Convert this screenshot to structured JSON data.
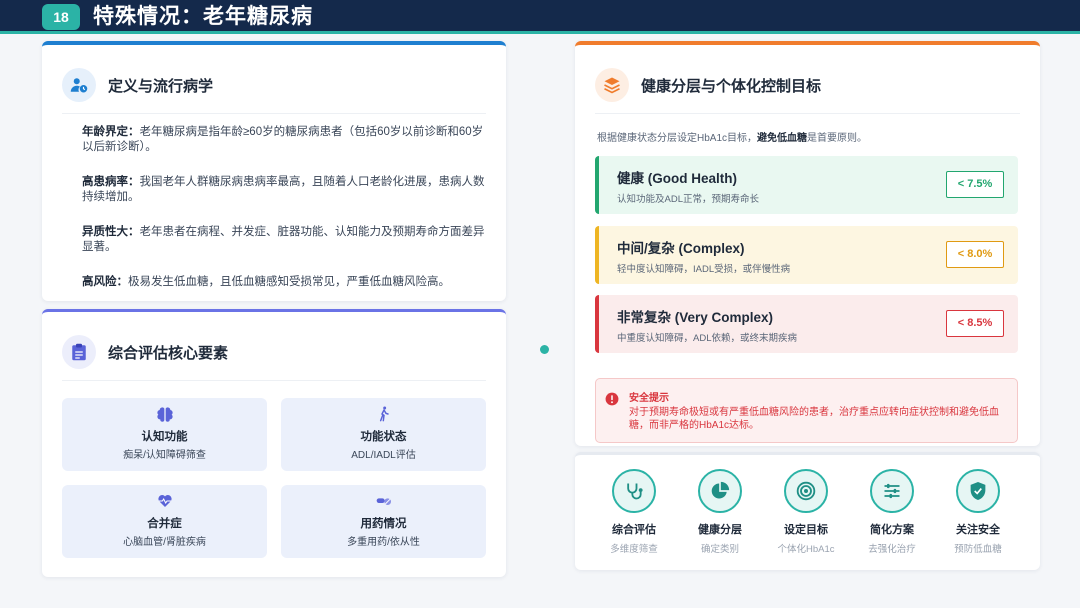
{
  "header": {
    "slide_number": "18",
    "title": "特殊情况：老年糖尿病"
  },
  "colors": {
    "navy": "#14294b",
    "teal": "#2bb3a6",
    "blue": "#1e7fd0",
    "indigo": "#6a73e6",
    "orange": "#f07c2c",
    "green": "#22a66f",
    "amber": "#eeb523",
    "red": "#d9363e"
  },
  "definition": {
    "title": "定义与流行病学",
    "icon": "user-clock-icon",
    "items": [
      {
        "term": "年龄界定：",
        "text": "老年糖尿病是指年龄≥60岁的糖尿病患者（包括60岁以前诊断和60岁以后新诊断）。"
      },
      {
        "term": "高患病率：",
        "text": "我国老年人群糖尿病患病率最高，且随着人口老龄化进展，患病人数持续增加。"
      },
      {
        "term": "异质性大：",
        "text": "老年患者在病程、并发症、脏器功能、认知能力及预期寿命方面差异显著。"
      },
      {
        "term": "高风险：",
        "text": "极易发生低血糖，且低血糖感知受损常见，严重低血糖风险高。"
      }
    ]
  },
  "evaluation": {
    "title": "综合评估核心要素",
    "icon": "clipboard-icon",
    "tiles": [
      {
        "title": "认知功能",
        "sub": "痴呆/认知障碍筛查",
        "icon": "brain-icon"
      },
      {
        "title": "功能状态",
        "sub": "ADL/IADL评估",
        "icon": "walking-icon"
      },
      {
        "title": "合并症",
        "sub": "心脑血管/肾脏疾病",
        "icon": "heartbeat-icon"
      },
      {
        "title": "用药情况",
        "sub": "多重用药/依从性",
        "icon": "pills-icon"
      }
    ]
  },
  "stratification": {
    "title": "健康分层与个体化控制目标",
    "icon": "layers-icon",
    "intro_prefix": "根据健康状态分层设定HbA1c目标，",
    "intro_bold": "避免低血糖",
    "intro_suffix": "是首要原则。",
    "tiers": [
      {
        "name": "健康 (Good Health)",
        "desc": "认知功能及ADL正常，预期寿命长",
        "target": "< 7.5%"
      },
      {
        "name": "中间/复杂 (Complex)",
        "desc": "轻中度认知障碍，IADL受损，或伴慢性病",
        "target": "< 8.0%"
      },
      {
        "name": "非常复杂 (Very Complex)",
        "desc": "中重度认知障碍，ADL依赖，或终末期疾病",
        "target": "< 8.5%"
      }
    ],
    "safety": {
      "icon": "alert-circle-icon",
      "title": "安全提示",
      "text": "对于预期寿命极短或有严重低血糖风险的患者，治疗重点应转向症状控制和避免低血糖，而非严格的HbA1c达标。"
    }
  },
  "steps": [
    {
      "title": "综合评估",
      "sub": "多维度筛查",
      "icon": "stethoscope-icon"
    },
    {
      "title": "健康分层",
      "sub": "确定类别",
      "icon": "pie-chart-icon"
    },
    {
      "title": "设定目标",
      "sub": "个体化HbA1c",
      "icon": "target-icon"
    },
    {
      "title": "简化方案",
      "sub": "去强化治疗",
      "icon": "sliders-icon"
    },
    {
      "title": "关注安全",
      "sub": "预防低血糖",
      "icon": "shield-icon"
    }
  ]
}
